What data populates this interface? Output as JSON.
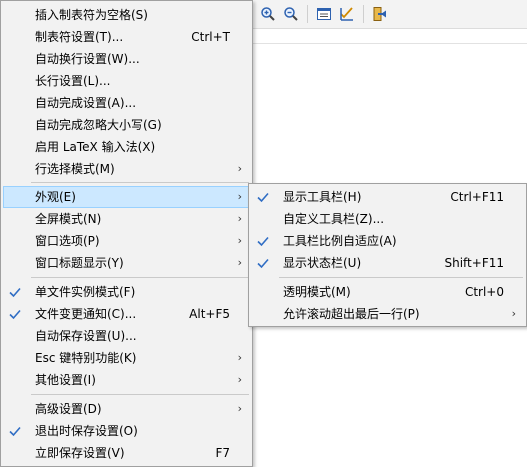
{
  "colors": {
    "menu_bg": "#f2f2f2",
    "highlight_bg": "#cce8ff",
    "highlight_border": "#99d1ff",
    "check_color": "#2f6dc4"
  },
  "main_menu": {
    "items": [
      {
        "label": "插入制表符为空格(S)",
        "shortcut": "",
        "submenu": false,
        "checked": false
      },
      {
        "label": "制表符设置(T)...",
        "shortcut": "Ctrl+T",
        "submenu": false,
        "checked": false
      },
      {
        "label": "自动换行设置(W)...",
        "shortcut": "",
        "submenu": false,
        "checked": false
      },
      {
        "label": "长行设置(L)...",
        "shortcut": "",
        "submenu": false,
        "checked": false
      },
      {
        "label": "自动完成设置(A)...",
        "shortcut": "",
        "submenu": false,
        "checked": false
      },
      {
        "label": "自动完成忽略大小写(G)",
        "shortcut": "",
        "submenu": false,
        "checked": false
      },
      {
        "label": "启用 LaTeX 输入法(X)",
        "shortcut": "",
        "submenu": false,
        "checked": false
      },
      {
        "label": "行选择模式(M)",
        "shortcut": "",
        "submenu": true,
        "checked": false
      },
      {
        "label": "外观(E)",
        "shortcut": "",
        "submenu": true,
        "checked": false,
        "highlighted": true
      },
      {
        "label": "全屏模式(N)",
        "shortcut": "",
        "submenu": true,
        "checked": false
      },
      {
        "label": "窗口选项(P)",
        "shortcut": "",
        "submenu": true,
        "checked": false
      },
      {
        "label": "窗口标题显示(Y)",
        "shortcut": "",
        "submenu": true,
        "checked": false
      },
      {
        "label": "单文件实例模式(F)",
        "shortcut": "",
        "submenu": false,
        "checked": true
      },
      {
        "label": "文件变更通知(C)...",
        "shortcut": "Alt+F5",
        "submenu": false,
        "checked": true
      },
      {
        "label": "自动保存设置(U)...",
        "shortcut": "",
        "submenu": false,
        "checked": false
      },
      {
        "label": "Esc 键特别功能(K)",
        "shortcut": "",
        "submenu": true,
        "checked": false
      },
      {
        "label": "其他设置(I)",
        "shortcut": "",
        "submenu": true,
        "checked": false
      },
      {
        "label": "高级设置(D)",
        "shortcut": "",
        "submenu": true,
        "checked": false
      },
      {
        "label": "退出时保存设置(O)",
        "shortcut": "",
        "submenu": false,
        "checked": true
      },
      {
        "label": "立即保存设置(V)",
        "shortcut": "F7",
        "submenu": false,
        "checked": false
      }
    ]
  },
  "appearance_submenu": {
    "items": [
      {
        "label": "显示工具栏(H)",
        "shortcut": "Ctrl+F11",
        "submenu": false,
        "checked": true
      },
      {
        "label": "自定义工具栏(Z)...",
        "shortcut": "",
        "submenu": false,
        "checked": false
      },
      {
        "label": "工具栏比例自适应(A)",
        "shortcut": "",
        "submenu": false,
        "checked": true
      },
      {
        "label": "显示状态栏(U)",
        "shortcut": "Shift+F11",
        "submenu": false,
        "checked": true
      },
      {
        "label": "透明模式(M)",
        "shortcut": "Ctrl+0",
        "submenu": false,
        "checked": false
      },
      {
        "label": "允许滚动超出最后一行(P)",
        "shortcut": "",
        "submenu": true,
        "checked": false
      }
    ]
  },
  "glyphs": {
    "arrow": "›"
  },
  "toolbar": {
    "icons": [
      "zoom-in-icon",
      "zoom-out-icon",
      "view-options-icon",
      "edit-check-icon",
      "exit-icon"
    ]
  }
}
